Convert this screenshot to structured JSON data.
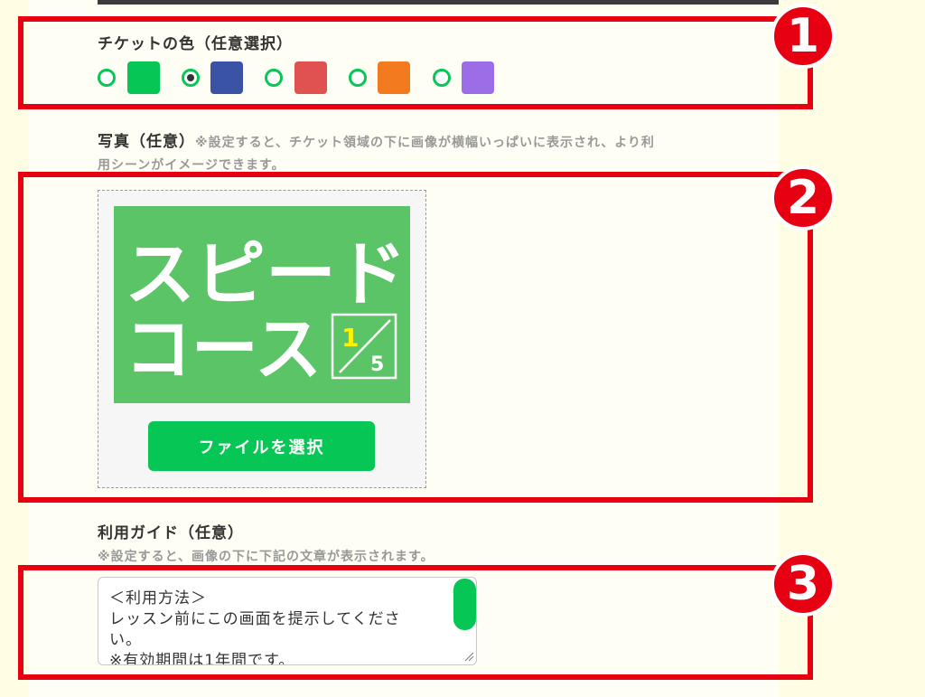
{
  "color_section": {
    "label": "チケットの色（任意選択）",
    "options": [
      {
        "color": "#06c755",
        "selected": false
      },
      {
        "color": "#3a53a4",
        "selected": true
      },
      {
        "color": "#e05252",
        "selected": false
      },
      {
        "color": "#f47a20",
        "selected": false
      },
      {
        "color": "#9b6ee8",
        "selected": false
      }
    ]
  },
  "photo_section": {
    "label": "写真（任意）",
    "note_line1": "※設定すると、チケット領域の下に画像が横幅いっぱいに表示され、より利",
    "note_line2": "用シーンがイメージできます。",
    "preview": {
      "line1": "スピード",
      "line2": "コース",
      "fraction_top": "1",
      "fraction_bottom": "5",
      "background": "#5bc466"
    },
    "file_button": "ファイルを選択"
  },
  "guide_section": {
    "label": "利用ガイド（任意）",
    "note": "※設定すると、画像の下に下記の文章が表示されます。",
    "textarea_lines": [
      "＜利用方法＞",
      "レッスン前にこの画面を提示してくださ",
      "い。",
      "※有効期間は1年間です。"
    ]
  },
  "badges": [
    "1",
    "2",
    "3"
  ],
  "colors": {
    "accent": "#06c755",
    "highlight": "#e60012"
  }
}
